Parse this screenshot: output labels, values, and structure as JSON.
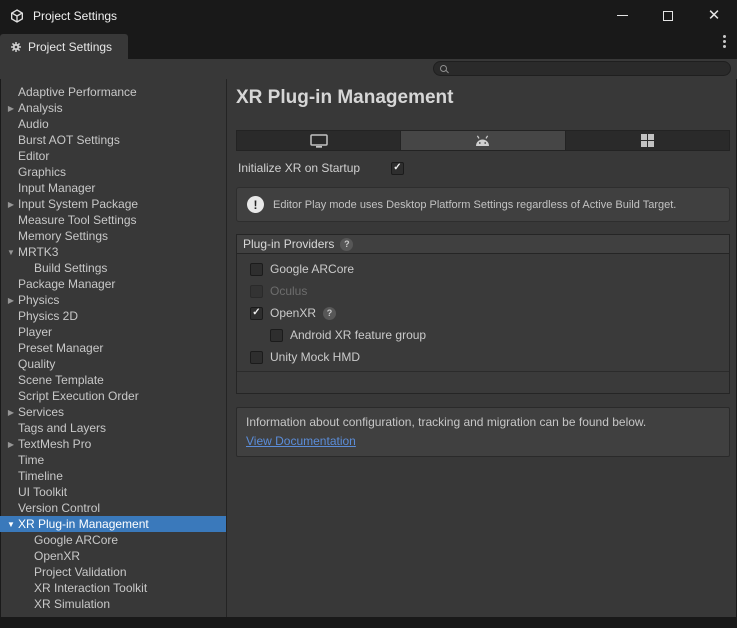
{
  "icons": {
    "check": "✓",
    "help": "?",
    "exclamation": "!",
    "arrow_collapsed": "▶",
    "arrow_expanded": "▼"
  },
  "titlebar": {
    "title": "Project Settings"
  },
  "header_tab": {
    "label": "Project Settings"
  },
  "search": {
    "value": "",
    "placeholder": ""
  },
  "sidebar": {
    "items": [
      {
        "label": "Adaptive Performance"
      },
      {
        "label": "Analysis",
        "expandable": true,
        "expanded": false
      },
      {
        "label": "Audio"
      },
      {
        "label": "Burst AOT Settings"
      },
      {
        "label": "Editor"
      },
      {
        "label": "Graphics"
      },
      {
        "label": "Input Manager"
      },
      {
        "label": "Input System Package",
        "expandable": true,
        "expanded": false
      },
      {
        "label": "Measure Tool Settings"
      },
      {
        "label": "Memory Settings"
      },
      {
        "label": "MRTK3",
        "expandable": true,
        "expanded": true
      },
      {
        "label": "Build Settings",
        "indent": 1
      },
      {
        "label": "Package Manager"
      },
      {
        "label": "Physics",
        "expandable": true,
        "expanded": false
      },
      {
        "label": "Physics 2D"
      },
      {
        "label": "Player"
      },
      {
        "label": "Preset Manager"
      },
      {
        "label": "Quality"
      },
      {
        "label": "Scene Template"
      },
      {
        "label": "Script Execution Order"
      },
      {
        "label": "Services",
        "expandable": true,
        "expanded": false
      },
      {
        "label": "Tags and Layers"
      },
      {
        "label": "TextMesh Pro",
        "expandable": true,
        "expanded": false
      },
      {
        "label": "Time"
      },
      {
        "label": "Timeline"
      },
      {
        "label": "UI Toolkit"
      },
      {
        "label": "Version Control"
      },
      {
        "label": "XR Plug-in Management",
        "expandable": true,
        "expanded": true,
        "selected": true
      },
      {
        "label": "Google ARCore",
        "indent": 1
      },
      {
        "label": "OpenXR",
        "indent": 1
      },
      {
        "label": "Project Validation",
        "indent": 1
      },
      {
        "label": "XR Interaction Toolkit",
        "indent": 1
      },
      {
        "label": "XR Simulation",
        "indent": 1
      }
    ]
  },
  "main": {
    "title": "XR Plug-in Management",
    "platform_tabs": [
      {
        "name": "desktop",
        "active": false
      },
      {
        "name": "android",
        "active": true
      },
      {
        "name": "windows",
        "active": false
      }
    ],
    "initialize": {
      "label": "Initialize XR on Startup",
      "checked": true
    },
    "warning": "Editor Play mode uses Desktop Platform Settings regardless of Active Build Target.",
    "providers": {
      "header": "Plug-in Providers",
      "items": [
        {
          "label": "Google ARCore",
          "checked": false
        },
        {
          "label": "Oculus",
          "checked": false,
          "disabled": true
        },
        {
          "label": "OpenXR",
          "checked": true,
          "help": true
        },
        {
          "label": "Android XR feature group",
          "checked": false,
          "indent": 1
        },
        {
          "label": "Unity Mock HMD",
          "checked": false
        }
      ]
    },
    "documentation": {
      "text": "Information about configuration, tracking and migration can be found below.",
      "link": "View Documentation"
    }
  },
  "colors": {
    "selection": "#3A79BB",
    "link": "#5B8DD9"
  }
}
